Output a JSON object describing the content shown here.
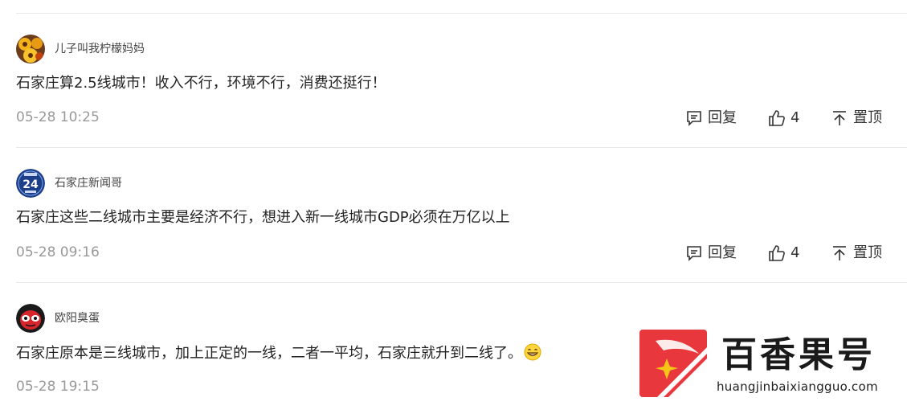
{
  "comments": [
    {
      "username": "儿子叫我柠檬妈妈",
      "content": "石家庄算2.5线城市！收入不行，环境不行，消费还挺行！",
      "time": "05-28 10:25",
      "reply_label": "回复",
      "like_count": "4",
      "pin_label": "置顶"
    },
    {
      "username": "石家庄新闻哥",
      "avatar_text": "24",
      "content": "石家庄这些二线城市主要是经济不行，想进入新一线城市GDP必须在万亿以上",
      "time": "05-28 09:16",
      "reply_label": "回复",
      "like_count": "4",
      "pin_label": "置顶"
    },
    {
      "username": "欧阳臭蛋",
      "content": "石家庄原本是三线城市，加上正定的一线，二者一平均，石家庄就升到二线了。",
      "time": "05-28 19:15"
    }
  ],
  "watermark": {
    "title": "百香果号",
    "url": "huangjinbaixiangguo.com"
  },
  "colors": {
    "meta_gray": "#999999",
    "divider": "#e8e8e8",
    "logo_red": "#e8383d",
    "logo_yellow": "#f5c518"
  }
}
